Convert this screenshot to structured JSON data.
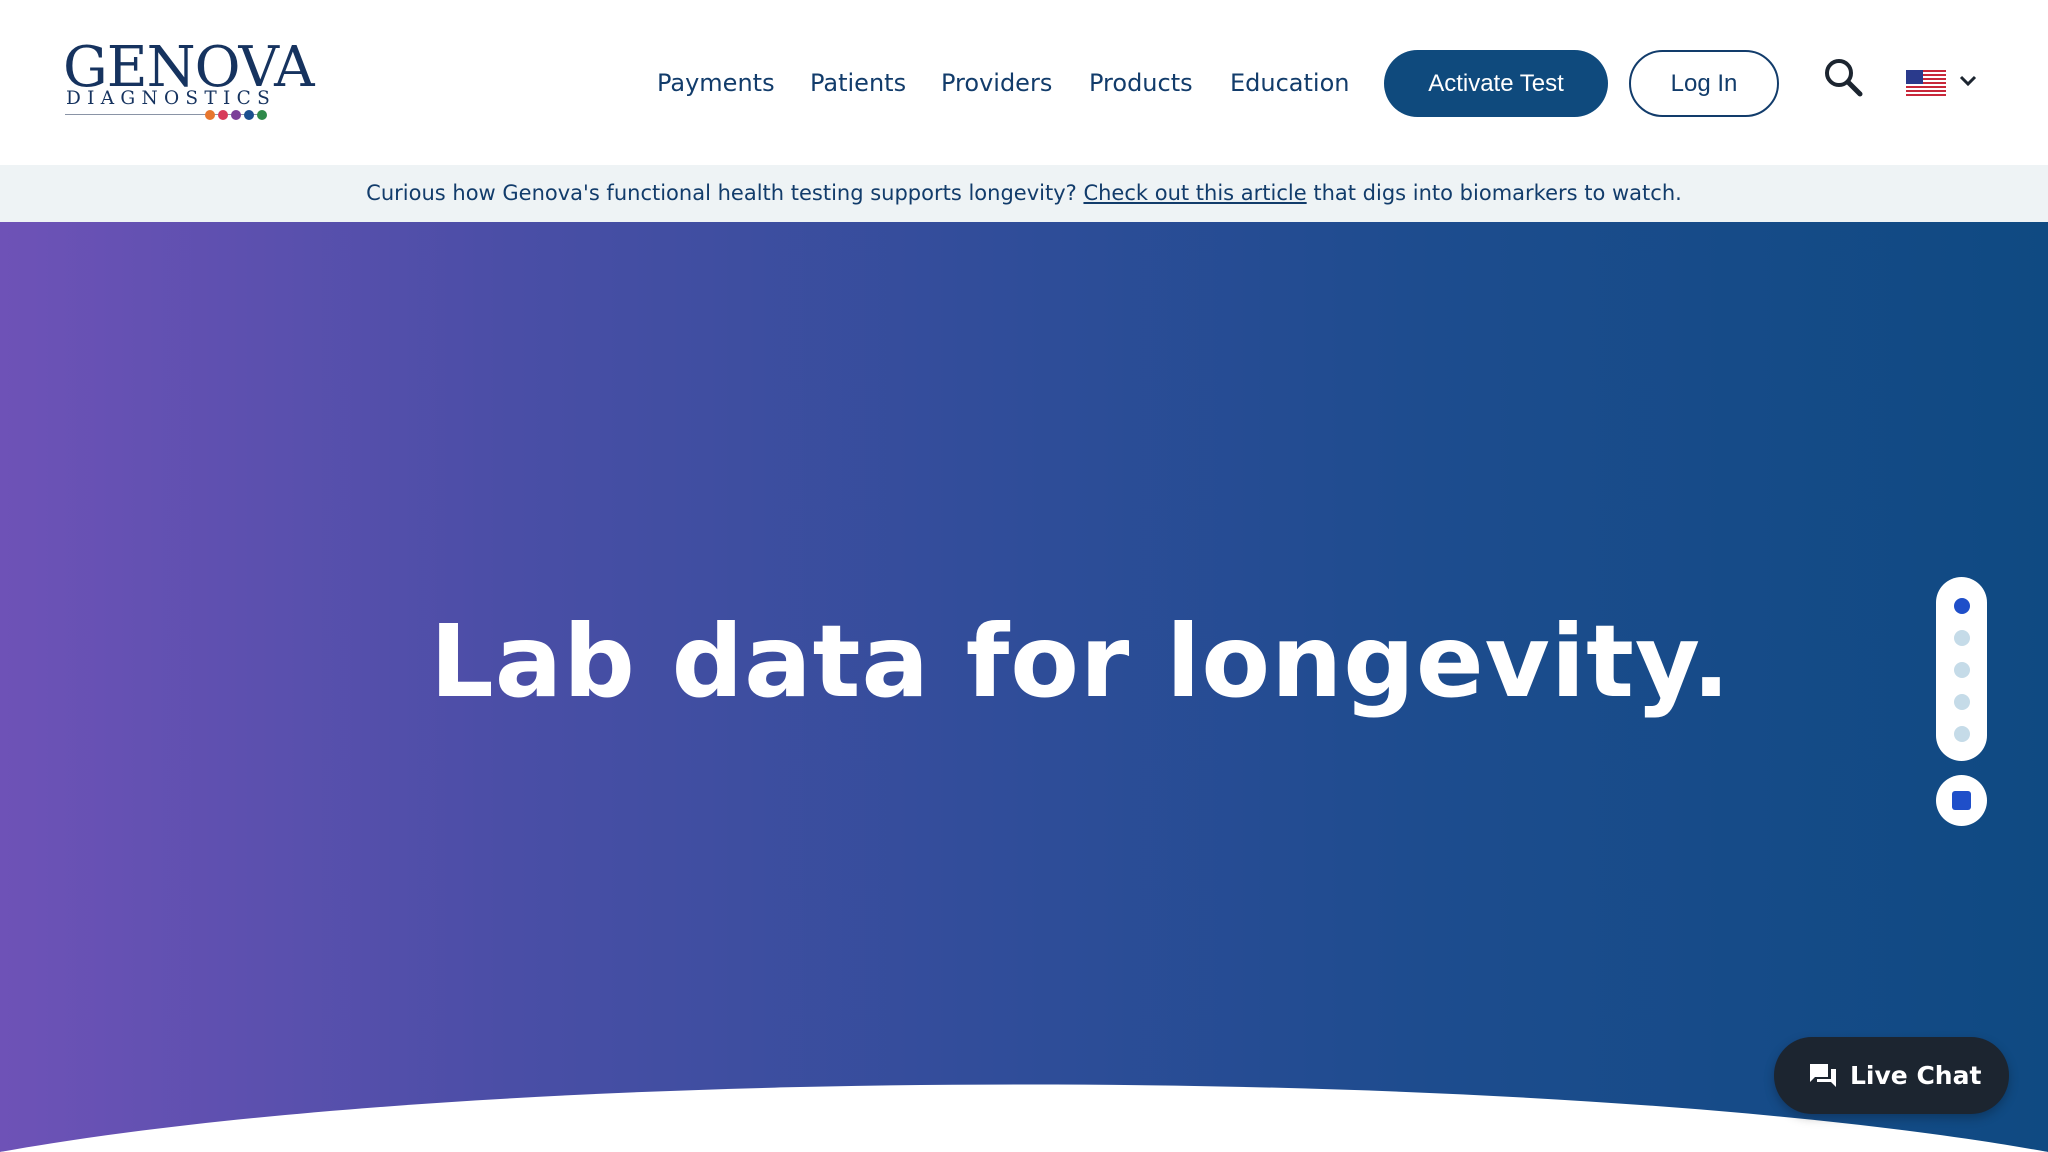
{
  "brand": {
    "logo_word": "GENOVA",
    "logo_sub": "DIAGNOSTICS",
    "logo_dot_colors": [
      "#e8772e",
      "#d83b5a",
      "#7b3f98",
      "#1b4f8f",
      "#2e8a4a"
    ]
  },
  "nav": {
    "items": [
      {
        "label": "Payments"
      },
      {
        "label": "Patients"
      },
      {
        "label": "Providers"
      },
      {
        "label": "Products"
      },
      {
        "label": "Education"
      }
    ],
    "activate_label": "Activate Test",
    "login_label": "Log In",
    "search_icon": "search-icon",
    "locale_icon": "us-flag-icon"
  },
  "announcement": {
    "before": "Curious how Genova's functional health testing supports longevity? ",
    "link": "Check out this article",
    "after": " that digs into biomarkers to watch."
  },
  "hero": {
    "title": "Lab data for longevity.",
    "slides_total": 5,
    "active_slide": 1
  },
  "chat": {
    "label": "Live Chat",
    "icon": "chat-bubble-icon"
  },
  "colors": {
    "primary": "#0f4a7d",
    "text": "#123c6b",
    "accent": "#1f4fc9",
    "gradient_start": "#6e52b7",
    "gradient_end": "#0f4a82"
  }
}
